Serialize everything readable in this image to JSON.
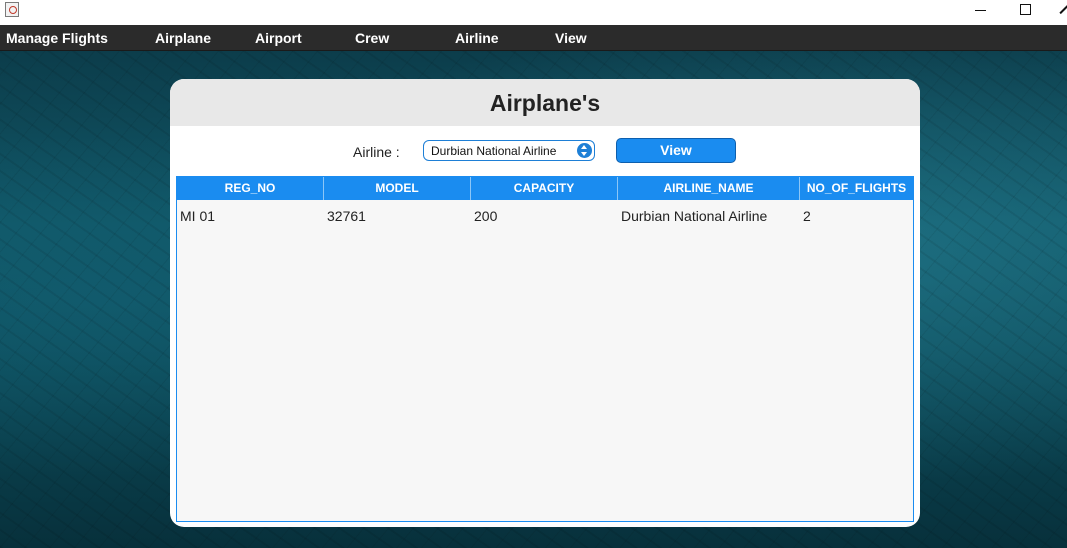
{
  "menu": {
    "items": [
      "Manage Flights",
      "Airplane",
      "Airport",
      "Crew",
      "Airline",
      "View"
    ]
  },
  "panel": {
    "title": "Airplane's",
    "filter_label": "Airline :",
    "airline_selected": "Durbian National Airline",
    "view_button": "View"
  },
  "table": {
    "columns": [
      "REG_NO",
      "MODEL",
      "CAPACITY",
      "AIRLINE_NAME",
      "NO_OF_FLIGHTS"
    ],
    "rows": [
      [
        "MI 01",
        "32761",
        "200",
        "Durbian National Airline",
        "2"
      ]
    ]
  },
  "colors": {
    "accent": "#1a8cf0",
    "menubar": "#2b2b2b",
    "header_bg": "#e8e8e8"
  },
  "icons": {
    "app": "java-app-icon",
    "minimize": "minimize-icon",
    "maximize": "maximize-icon",
    "close": "close-icon",
    "select": "dropdown-arrows-icon"
  }
}
